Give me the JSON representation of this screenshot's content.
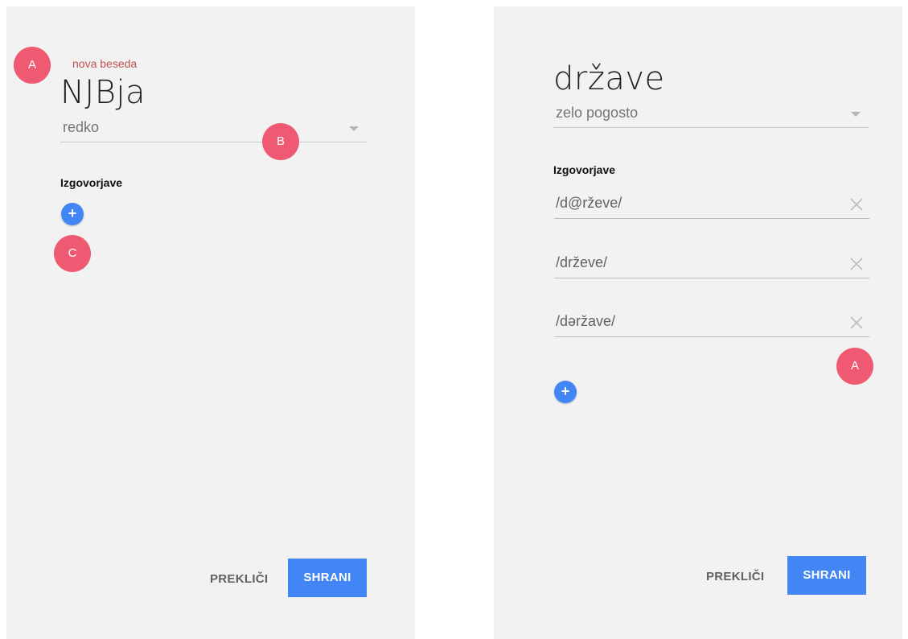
{
  "left": {
    "label": "nova beseda",
    "word": "NJBja",
    "frequency": "redko",
    "section_title": "Izgovorjave",
    "add_label": "+",
    "cancel_label": "PREKLIČI",
    "save_label": "SHRANI"
  },
  "right": {
    "word": "države",
    "frequency": "zelo pogosto",
    "section_title": "Izgovorjave",
    "pronunciations": [
      "/d@rževe/",
      "/drževe/",
      "/dəržave/"
    ],
    "add_label": "+",
    "cancel_label": "PREKLIČI",
    "save_label": "SHRANI"
  },
  "markers": {
    "left_a": "A",
    "left_b": "B",
    "left_c": "C",
    "right_a": "A"
  },
  "colors": {
    "accent": "#4285f4",
    "marker": "#ef5a72",
    "label_red": "#c0504d"
  }
}
